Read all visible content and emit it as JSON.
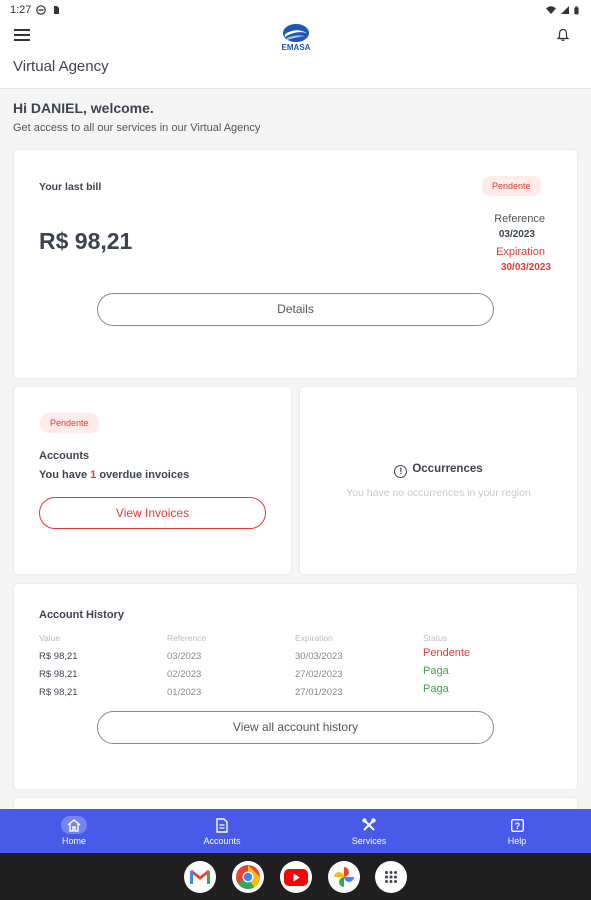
{
  "status_bar": {
    "time": "1:27"
  },
  "app_bar": {
    "logo_text": "EMASA"
  },
  "page_title": "Virtual Agency",
  "greeting": {
    "title": "Hi DANIEL, welcome.",
    "subtitle": "Get access to all our services in our Virtual Agency"
  },
  "last_bill": {
    "label": "Your last bill",
    "amount": "R$ 98,21",
    "status": "Pendente",
    "reference_label": "Reference",
    "reference_value": "03/2023",
    "expiration_label": "Expiration",
    "expiration_value": "30/03/2023",
    "details_button": "Details"
  },
  "accounts": {
    "status": "Pendente",
    "title": "Accounts",
    "line_prefix": "You have ",
    "overdue_count": "1",
    "line_suffix": " overdue invoices",
    "button": "View Invoices"
  },
  "occurrences": {
    "title": "Occurrences",
    "message": "You have no occurrences in your region"
  },
  "history": {
    "title": "Account History",
    "columns": [
      "Value",
      "Reference",
      "Expiration",
      "Status"
    ],
    "rows": [
      {
        "value": "R$ 98,21",
        "reference": "03/2023",
        "expiration": "30/03/2023",
        "status": "Pendente"
      },
      {
        "value": "R$ 98,21",
        "reference": "02/2023",
        "expiration": "27/02/2023",
        "status": "Paga"
      },
      {
        "value": "R$ 98,21",
        "reference": "01/2023",
        "expiration": "27/01/2023",
        "status": "Paga"
      }
    ],
    "button": "View all account history"
  },
  "bottom_nav": [
    {
      "label": "Home",
      "icon": "home-icon",
      "active": true
    },
    {
      "label": "Accounts",
      "icon": "document-icon",
      "active": false
    },
    {
      "label": "Services",
      "icon": "tools-icon",
      "active": false
    },
    {
      "label": "Help",
      "icon": "help-icon",
      "active": false
    }
  ],
  "dock": [
    "gmail-icon",
    "chrome-icon",
    "youtube-icon",
    "photos-icon",
    "apps-icon"
  ],
  "colors": {
    "accent": "#4a5ae8",
    "danger": "#e53935",
    "success": "#43a047",
    "text": "#3d4451",
    "background": "#f5f5f5"
  }
}
